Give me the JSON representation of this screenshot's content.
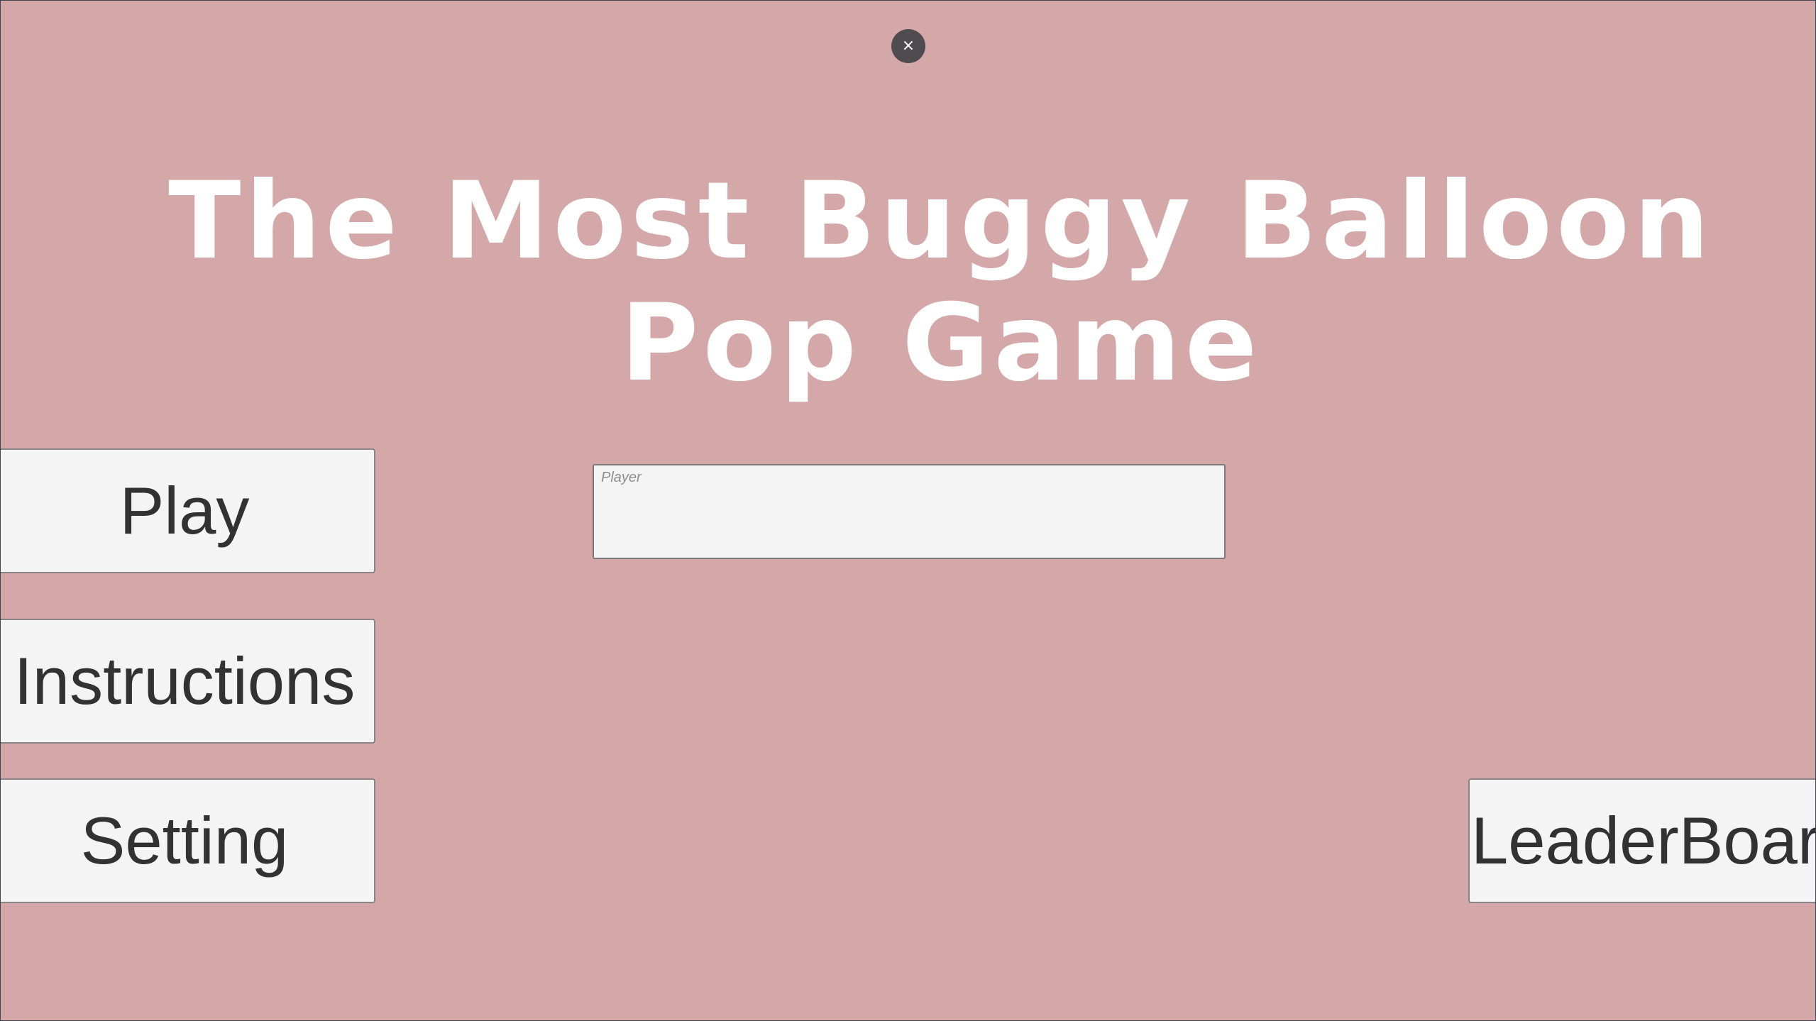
{
  "window": {
    "close_glyph": "×"
  },
  "title": {
    "text": "The Most Buggy Balloon Pop Game"
  },
  "menu": {
    "play_label": "Play",
    "instructions_label": "Instructions",
    "setting_label": "Setting",
    "leaderboard_label": "LeaderBoard"
  },
  "player_input": {
    "placeholder": "Player",
    "value": ""
  },
  "colors": {
    "background": "#d4a7a8",
    "title_text": "#ffffff",
    "button_bg": "#f4f4f4",
    "button_text": "#323232",
    "close_button_bg": "#4f4c50"
  },
  "icons": {
    "close": "close-icon"
  }
}
